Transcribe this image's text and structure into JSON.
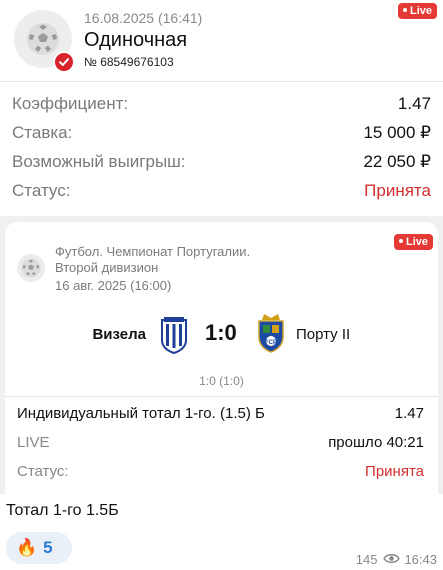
{
  "bet": {
    "date": "16.08.2025 (16:41)",
    "type": "Одиночная",
    "number": "№ 68549676103",
    "live_label": "Live"
  },
  "summary": {
    "coef_label": "Коэффициент:",
    "coef_value": "1.47",
    "stake_label": "Ставка:",
    "stake_value": "15 000 ₽",
    "win_label": "Возможный выигрыш:",
    "win_value": "22 050 ₽",
    "status_label": "Статус:",
    "status_value": "Принята"
  },
  "event": {
    "live_label": "Live",
    "league_line1": "Футбол. Чемпионат Португалии.",
    "league_line2": "Второй дивизион",
    "date": "16 авг. 2025 (16:00)",
    "home_team": "Визела",
    "away_team": "Порту II",
    "score": "1:0",
    "halftime": "1:0 (1:0)",
    "market": "Индивидуальный тотал 1-го. (1.5) Б",
    "market_coef": "1.47",
    "live_text": "LIVE",
    "elapsed": "прошло 40:21",
    "status_label": "Статус:",
    "status_value": "Принята"
  },
  "message": {
    "caption": "Тотал 1-го 1.5Б",
    "reaction_emoji": "🔥",
    "reaction_count": "5",
    "views": "145",
    "time": "16:43"
  },
  "colors": {
    "accent_red": "#d32f2f",
    "live_red": "#e53935",
    "reaction_blue": "#2a7ad3"
  },
  "icons": [
    "soccer-ball-icon",
    "check-badge-icon",
    "eye-icon",
    "fire-icon"
  ]
}
